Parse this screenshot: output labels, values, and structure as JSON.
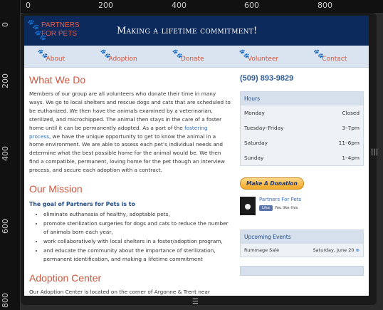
{
  "rulers": {
    "top": [
      "0",
      "200",
      "400",
      "600",
      "800"
    ],
    "left": [
      "0",
      "200",
      "400",
      "600",
      "800"
    ]
  },
  "header": {
    "logo_line1": "PARTNERS",
    "logo_line2": "FOR PETS",
    "tagline": "Making a lifetime commitment!"
  },
  "nav": [
    "About",
    "Adoption",
    "Donate",
    "Volunteer",
    "Contact"
  ],
  "main": {
    "what_title": "What We Do",
    "what_p1_a": "Members of our group are all volunteers who donate their time in many ways. We go to local shelters and rescue dogs and cats that are scheduled to be euthanized. We then have the animals examined by a veterinarian, sterilized, and microchipped. The animal then stays in the care of a foster home until it can be permanently adopted. As a part of the ",
    "what_link": "fostering process",
    "what_p1_b": ", we have the unique opportunity to get to know the animal in a home environment. We are able to assess each pet’s individual needs and determine what the best possible home for the animal would be. We then find a compatible, permanent, loving home for the pet though an interview process, and secure each adoption with a contract.",
    "mission_title": "Our Mission",
    "goal": "The goal of Partners for Pets is to",
    "mission_items": [
      "eliminate euthanasia of healthy, adoptable pets,",
      "promote sterilization surgeries for dogs and cats to reduce the number of animals born each year,",
      "work collaboratively with local shelters in a foster/adoption program,",
      "and educate the community about the importance of sterilization, permanent identification, and making a lifetime commitment"
    ],
    "center_title": "Adoption Center",
    "center_p": "Our Adoption Center is located on the corner of Argonne & Trent near Albertsons. Take the Argonne exit off I-90 and go north through three stoplights to Trent. Our"
  },
  "side": {
    "phone": "(509) 893-9829",
    "hours_title": "Hours",
    "hours": [
      {
        "day": "Monday",
        "time": "Closed"
      },
      {
        "day": "Tuesday–Friday",
        "time": "3–7pm"
      },
      {
        "day": "Saturday",
        "time": "11–6pm"
      },
      {
        "day": "Sunday",
        "time": "1–4pm"
      }
    ],
    "donate_label": "Make A Donation",
    "fb_name": "Partners For Pets",
    "fb_like_label": "Like",
    "fb_like_text": "You like this",
    "events_title": "Upcoming Events",
    "events": [
      {
        "name": "Rummage Sale",
        "date": "Saturday, June 20"
      }
    ]
  }
}
